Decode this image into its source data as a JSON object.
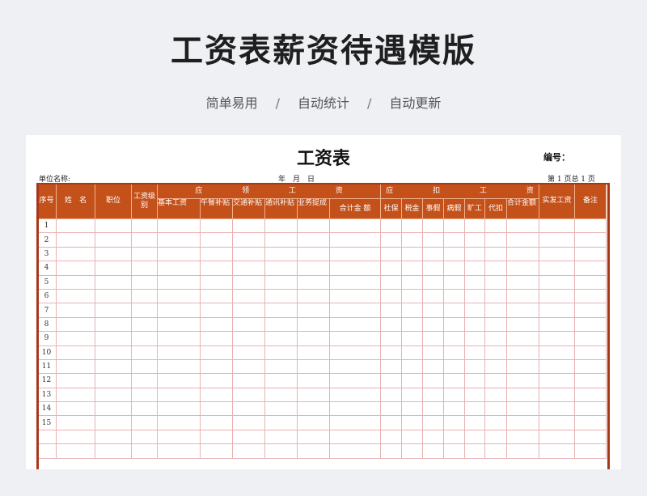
{
  "banner": {
    "title": "工资表薪资待遇模版",
    "features": [
      "简单易用",
      "自动统计",
      "自动更新"
    ],
    "separator": "/"
  },
  "sheet": {
    "title": "工资表",
    "number_label": "编号：",
    "unit_label": "单位名称:",
    "date_label": "年　月　日",
    "page_label": "第 1 页总 1 页",
    "headers": {
      "seq": "序号",
      "name": "姓　名",
      "position": "职位",
      "grade": "工资级别",
      "payable_group": "应 领 工 资",
      "deduction_group": "应 扣 工 资",
      "net_pay": "实发工资",
      "remarks": "备注",
      "payable_items": [
        "基本工资",
        "午餐补贴",
        "交通补贴",
        "通讯补贴",
        "业务提成",
        "合计金 额"
      ],
      "deduction_items": [
        "社保",
        "税金",
        "事假",
        "病假",
        "旷工",
        "代扣",
        "合计金额"
      ]
    },
    "row_numbers": [
      "1",
      "2",
      "3",
      "4",
      "5",
      "6",
      "7",
      "8",
      "9",
      "10",
      "11",
      "12",
      "13",
      "14",
      "15",
      "",
      ""
    ],
    "colors": {
      "header_bg": "#c4511a",
      "border": "#a8371a",
      "grid": "#e8b2b2"
    }
  }
}
